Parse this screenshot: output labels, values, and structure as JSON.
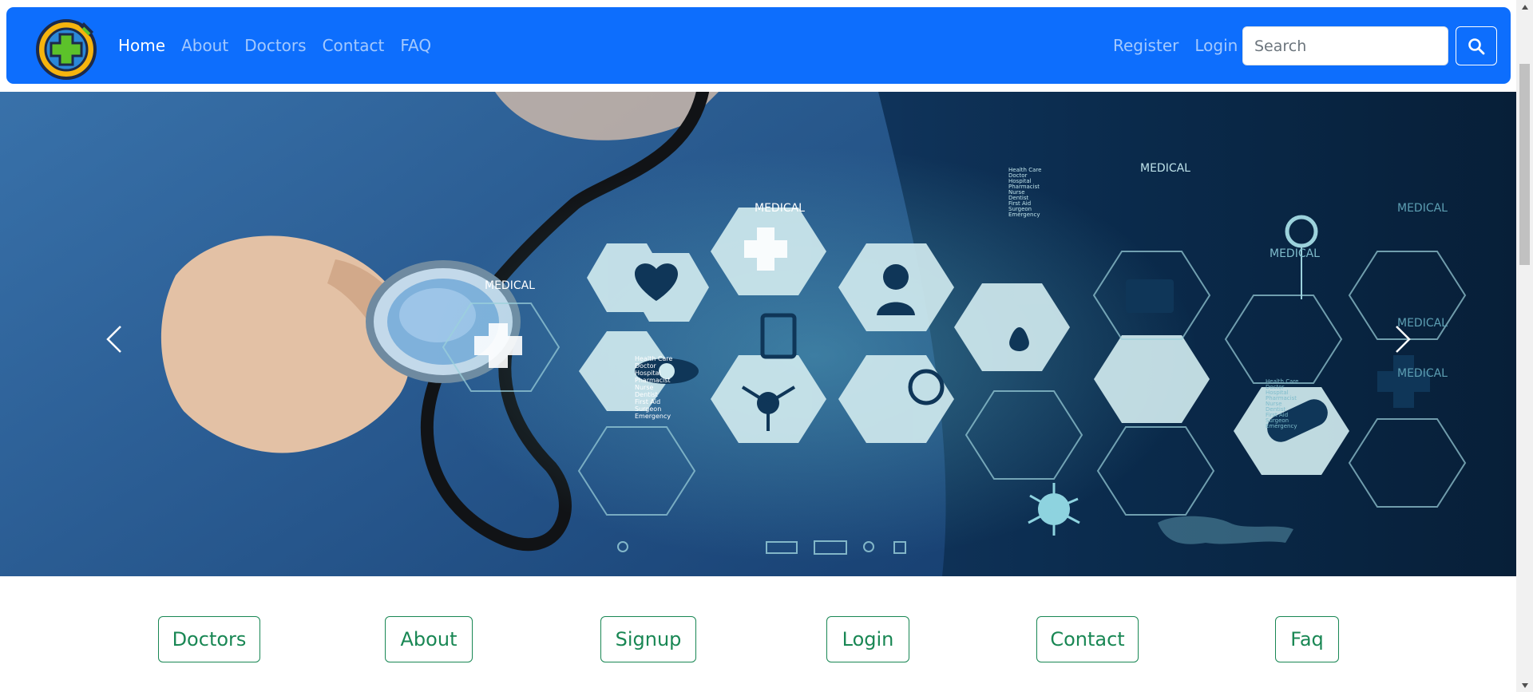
{
  "navbar": {
    "logo_alt": "medical cross logo",
    "links": [
      {
        "label": "Home",
        "active": true
      },
      {
        "label": "About"
      },
      {
        "label": "Doctors"
      },
      {
        "label": "Contact"
      },
      {
        "label": "FAQ"
      }
    ],
    "register_label": "Register",
    "login_label": "Login",
    "search_placeholder": "Search",
    "search_icon": "search-icon"
  },
  "hero": {
    "hex_label": "MEDICAL",
    "list_text": [
      "Health Care",
      "Doctor",
      "Hospital",
      "Pharmacist",
      "Nurse",
      "Dentist",
      "First Aid",
      "Surgeon",
      "Emergency"
    ],
    "prev_icon": "chevron-left-icon",
    "next_icon": "chevron-right-icon"
  },
  "quick_links": [
    {
      "label": "Doctors"
    },
    {
      "label": "About"
    },
    {
      "label": "Signup"
    },
    {
      "label": "Login"
    },
    {
      "label": "Contact"
    },
    {
      "label": "Faq"
    }
  ],
  "colors": {
    "navbar_bg": "#0d6efd",
    "quick_link": "#198754",
    "hero_dark": "#0a2a4b",
    "hex_light": "#cfe9ee"
  }
}
